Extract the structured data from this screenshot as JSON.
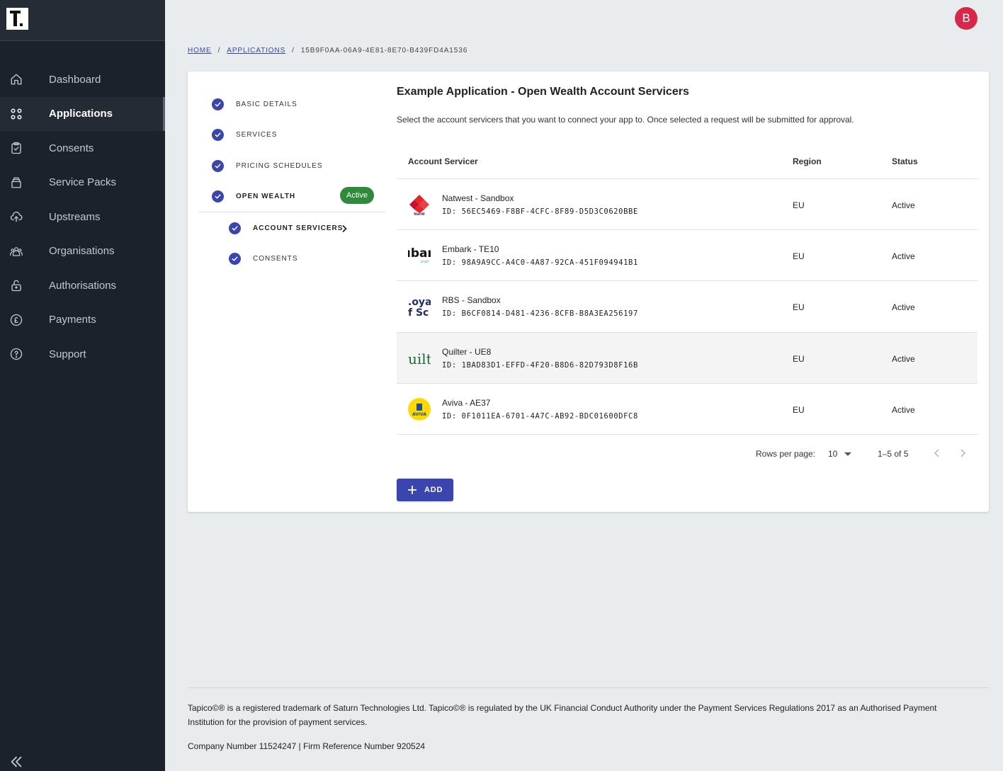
{
  "sidebar": {
    "items": [
      {
        "label": "Dashboard",
        "icon": "home-icon"
      },
      {
        "label": "Applications",
        "icon": "grid-icon"
      },
      {
        "label": "Consents",
        "icon": "clipboard-check-icon"
      },
      {
        "label": "Service Packs",
        "icon": "package-icon"
      },
      {
        "label": "Upstreams",
        "icon": "upload-cloud-icon"
      },
      {
        "label": "Organisations",
        "icon": "people-icon"
      },
      {
        "label": "Authorisations",
        "icon": "lock-icon"
      },
      {
        "label": "Payments",
        "icon": "pound-icon"
      },
      {
        "label": "Support",
        "icon": "help-icon"
      }
    ],
    "active": "Applications"
  },
  "header": {
    "avatar_initial": "B"
  },
  "breadcrumb": {
    "home": "HOME",
    "applications": "APPLICATIONS",
    "sep": "/",
    "current": "15B9F0AA-06A9-4E81-8E70-B439FD4A1536"
  },
  "stepper": {
    "steps": [
      {
        "label": "BASIC DETAILS"
      },
      {
        "label": "SERVICES"
      },
      {
        "label": "PRICING SCHEDULES"
      },
      {
        "label": "OPEN WEALTH",
        "badge": "Active"
      },
      {
        "label": "ACCOUNT SERVICERS"
      },
      {
        "label": "CONSENTS"
      }
    ]
  },
  "main": {
    "title": "Example Application - Open Wealth Account Servicers",
    "description": "Select the account servicers that you want to connect your app to. Once selected a request will be submitted for approval."
  },
  "table": {
    "headers": {
      "servicer": "Account Servicer",
      "region": "Region",
      "status": "Status"
    },
    "rows": [
      {
        "name": "Natwest - Sandbox",
        "id": "ID: 56EC5469-F8BF-4CFC-8F89-D5D3C0620BBE",
        "region": "EU",
        "status": "Active",
        "logo_text": "NatWest"
      },
      {
        "name": "Embark - TE10",
        "id": "ID: 98A9A9CC-A4C0-4A87-92CA-451F094941B1",
        "region": "EU",
        "status": "Active",
        "logo_text": "ıbaı",
        "logo_sub": "platf"
      },
      {
        "name": "RBS - Sandbox",
        "id": "ID: B6CF0814-D481-4236-8CFB-B8A3EA256197",
        "region": "EU",
        "status": "Active",
        "logo_text": ".oya",
        "logo_sub": "f Sc"
      },
      {
        "name": "Quilter - UE8",
        "id": "ID: 1BAD83D1-EFFD-4F20-B8D6-82D793D8F16B",
        "region": "EU",
        "status": "Active",
        "logo_text": "uilt"
      },
      {
        "name": "Aviva - AE37",
        "id": "ID: 0F1011EA-6701-4A7C-AB92-BDC01600DFC8",
        "region": "EU",
        "status": "Active",
        "logo_text": "AVIVA"
      }
    ]
  },
  "pagination": {
    "rows_per_page_label": "Rows per page:",
    "rows_per_page": "10",
    "range": "1–5 of 5"
  },
  "actions": {
    "add_label": "ADD"
  },
  "footer": {
    "text": "Tapico©® is a registered trademark of Saturn Technologies Ltd. Tapico©® is regulated by the UK Financial Conduct Authority under the Payment Services Regulations 2017 as an Authorised Payment Institution for the provision of payment services.",
    "company": "Company Number 11524247 | Firm Reference Number 920524"
  },
  "colors": {
    "sidebar_bg": "#1c222b",
    "accent": "#3a45ad",
    "badge_green": "#2f8a3c",
    "avatar": "#d7284b"
  }
}
